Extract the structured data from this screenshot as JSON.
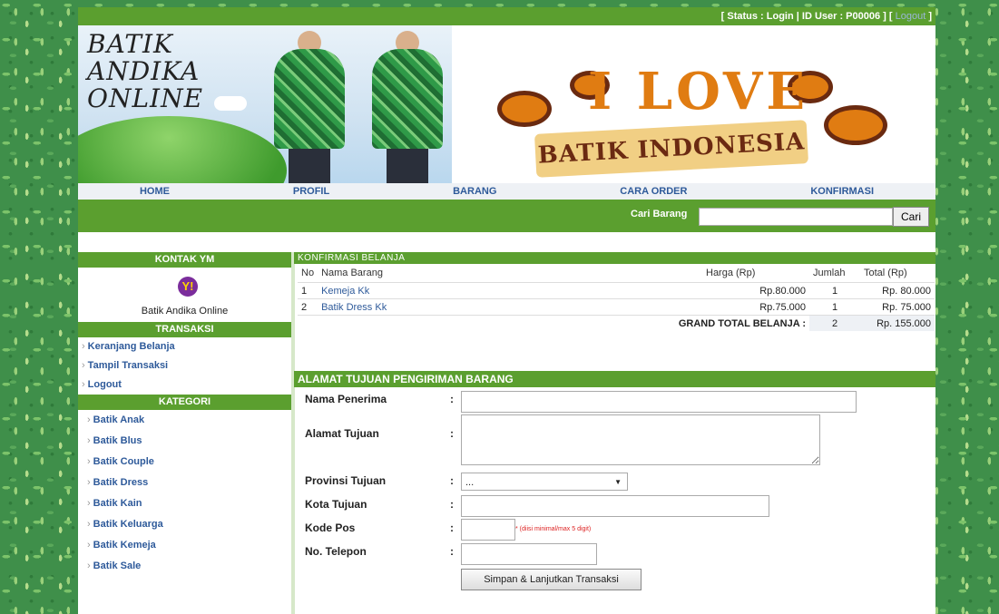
{
  "status": {
    "text": "[ Status : Login | ID User : P00006 ] [",
    "logout": "Logout",
    "close": "]"
  },
  "banner": {
    "logo": "BATIK ANDIKA ONLINE",
    "headline": "I LOVE",
    "ribbon": "BATIK INDONESIA"
  },
  "nav": [
    "HOME",
    "PROFIL",
    "BARANG",
    "CARA ORDER",
    "KONFIRMASI"
  ],
  "search": {
    "label": "Cari Barang",
    "value": "",
    "button": "Cari"
  },
  "sidebar": {
    "ym_title": "KONTAK YM",
    "ym_label": "Batik Andika Online",
    "trans_title": "TRANSAKSI",
    "trans_links": [
      "Keranjang Belanja",
      "Tampil Transaksi",
      "Logout"
    ],
    "cat_title": "KATEGORI",
    "categories": [
      "Batik Anak",
      "Batik Blus",
      "Batik Couple",
      "Batik Dress",
      "Batik Kain",
      "Batik Keluarga",
      "Batik Kemeja",
      "Batik Sale"
    ]
  },
  "order": {
    "title": "KONFIRMASI BELANJA",
    "headers": [
      "No",
      "Nama Barang",
      "Harga (Rp)",
      "Jumlah",
      "Total (Rp)"
    ],
    "rows": [
      [
        "1",
        "Kemeja Kk",
        "Rp.80.000",
        "1",
        "Rp. 80.000"
      ],
      [
        "2",
        "Batik Dress Kk",
        "Rp.75.000",
        "1",
        "Rp. 75.000"
      ]
    ],
    "grand_label": "GRAND TOTAL BELANJA :",
    "grand_qty": "2",
    "grand_total": "Rp. 155.000"
  },
  "address": {
    "title": "ALAMAT TUJUAN PENGIRIMAN BARANG",
    "fields": {
      "nama": "Nama Penerima",
      "alamat": "Alamat Tujuan",
      "provinsi": "Provinsi Tujuan",
      "kota": "Kota Tujuan",
      "kodepos": "Kode Pos",
      "telepon": "No. Telepon"
    },
    "colon": ":",
    "provinsi_selected": "...",
    "kodepos_hint": "* (diisi minimal/max 5 digit)",
    "submit": "Simpan & Lanjutkan Transaksi"
  }
}
